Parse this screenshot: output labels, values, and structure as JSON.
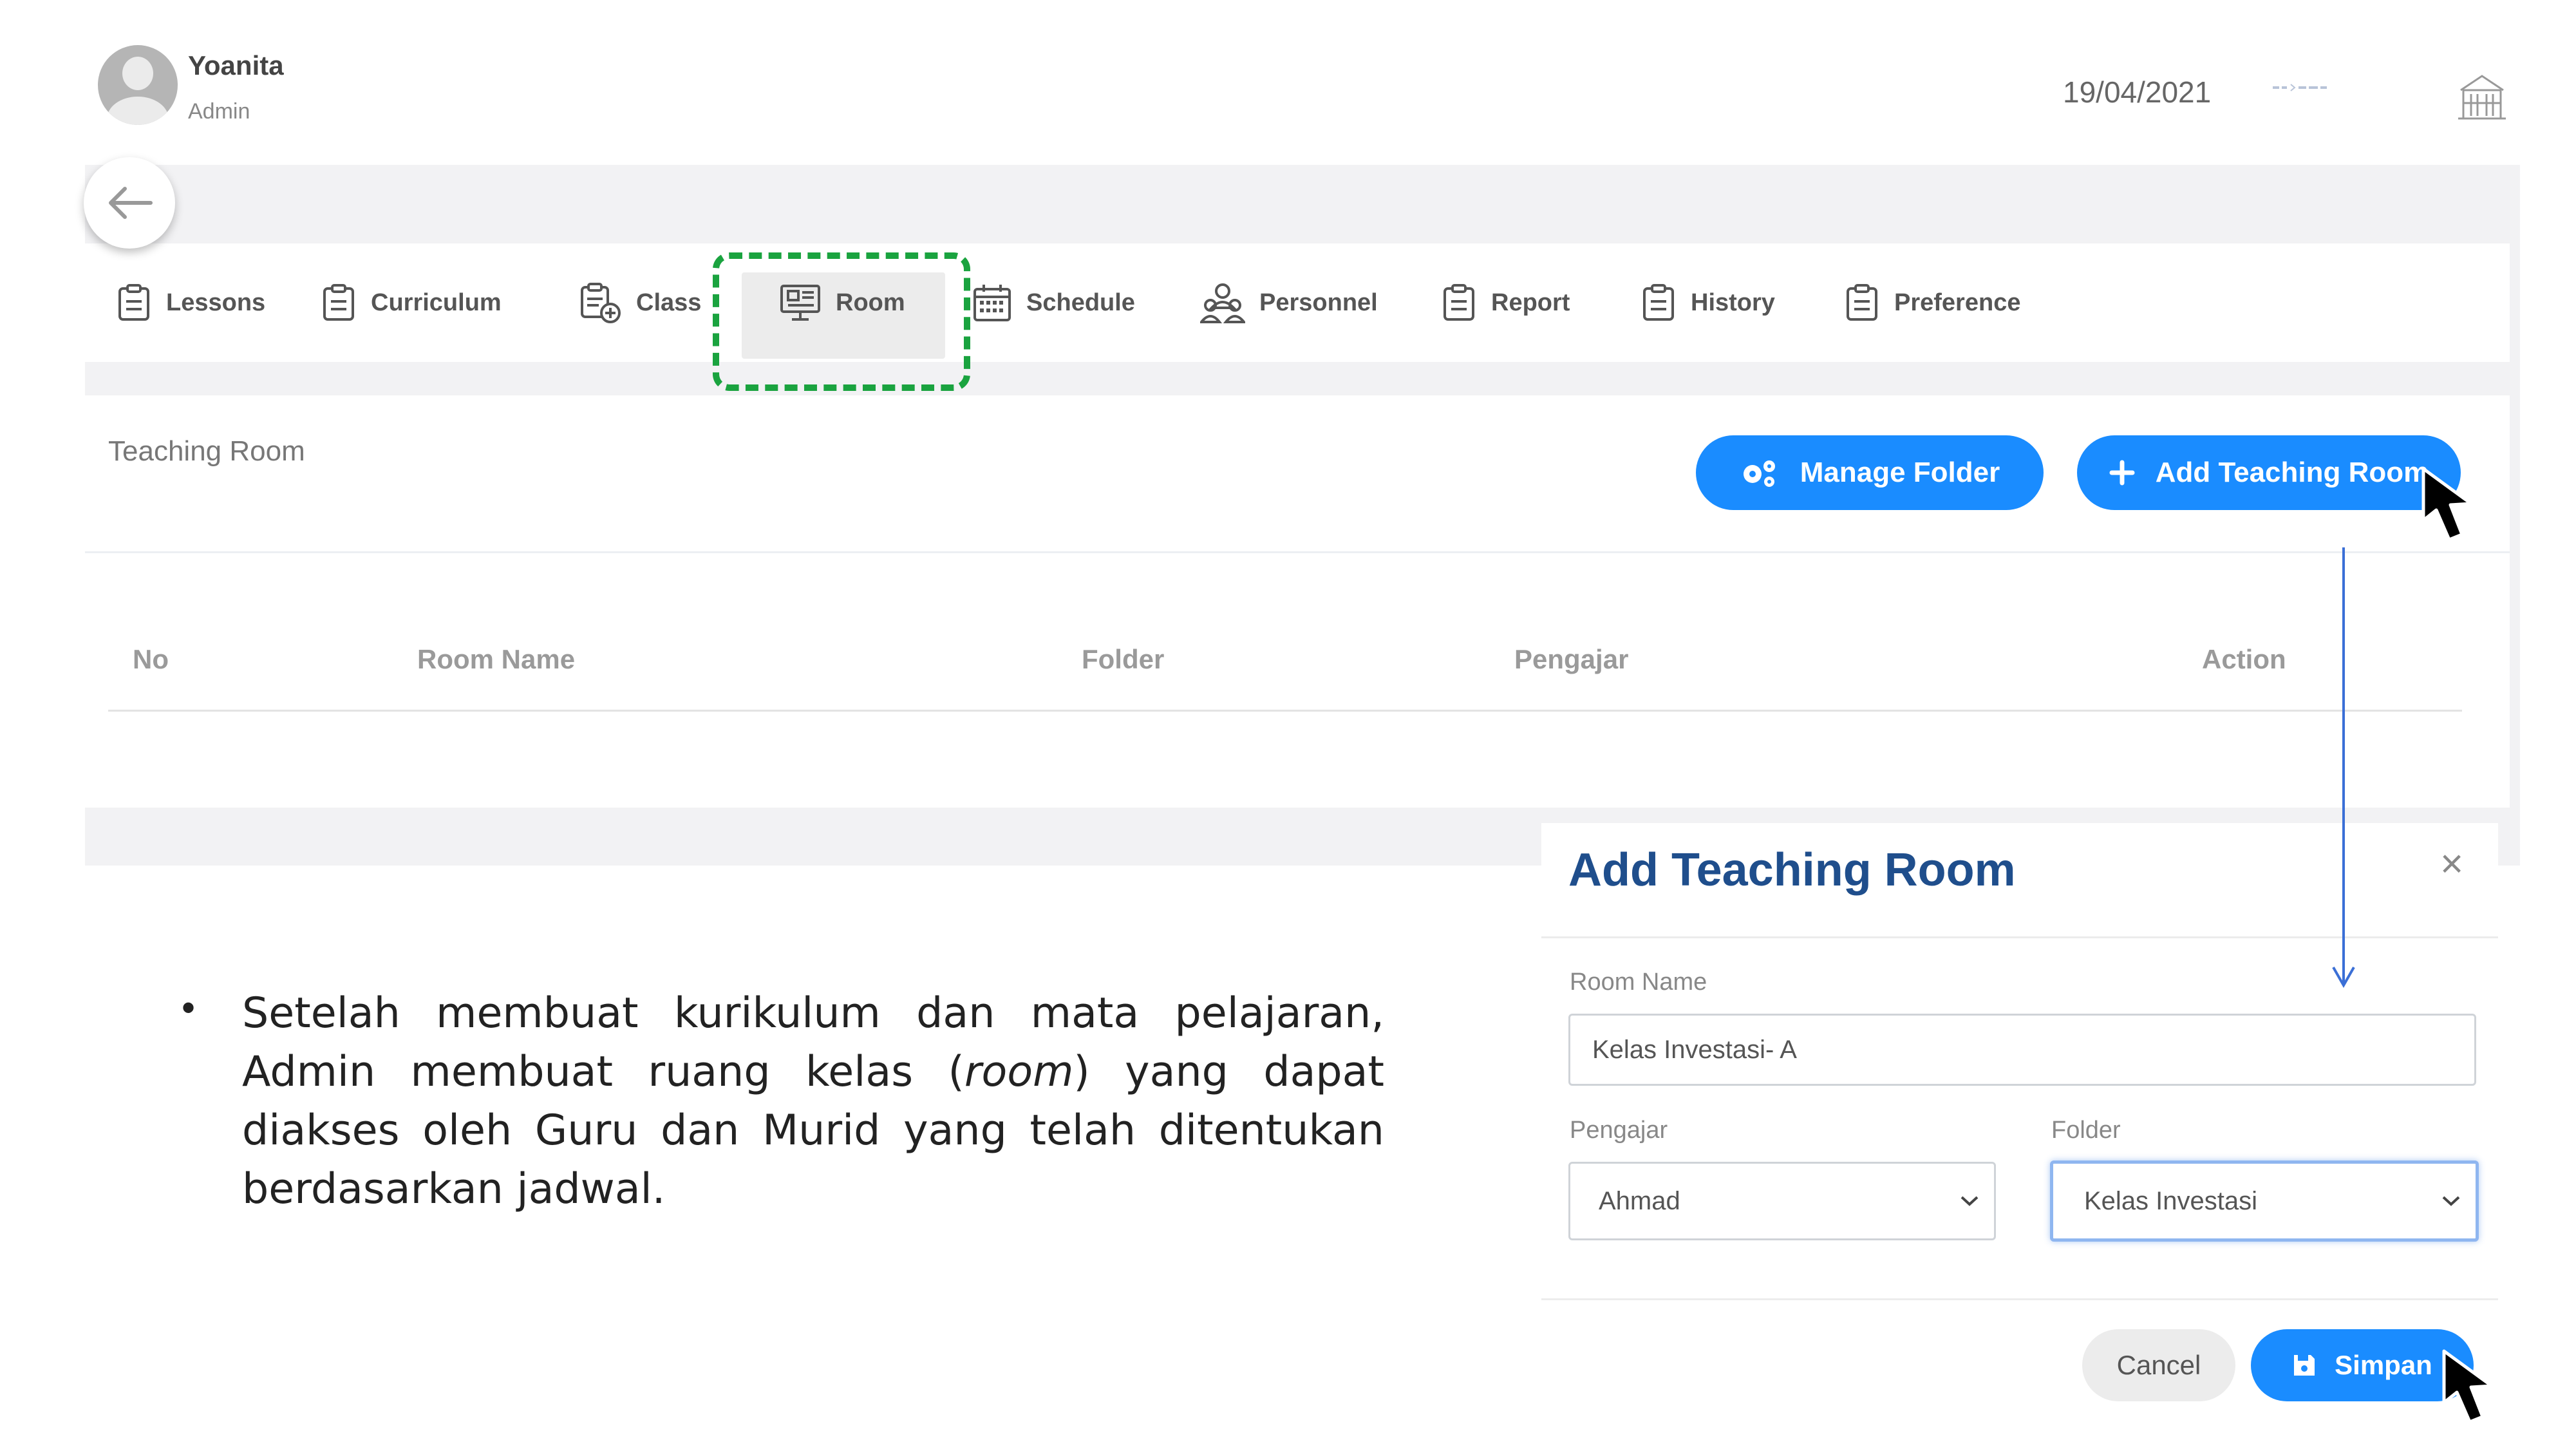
{
  "user": {
    "name": "Yoanita",
    "role": "Admin"
  },
  "header": {
    "date": "19/04/2021"
  },
  "nav": {
    "items": [
      {
        "label": "Lessons",
        "icon": "clipboard-icon"
      },
      {
        "label": "Curriculum",
        "icon": "clipboard-icon"
      },
      {
        "label": "Class",
        "icon": "clipboard-add-icon"
      },
      {
        "label": "Room",
        "icon": "monitor-icon"
      },
      {
        "label": "Schedule",
        "icon": "calendar-icon"
      },
      {
        "label": "Personnel",
        "icon": "people-icon"
      },
      {
        "label": "Report",
        "icon": "clipboard-icon"
      },
      {
        "label": "History",
        "icon": "clipboard-icon"
      },
      {
        "label": "Preference",
        "icon": "clipboard-icon"
      }
    ],
    "active": "Room"
  },
  "panel": {
    "title": "Teaching Room",
    "manage_folder_label": "Manage Folder",
    "add_room_label": "Add Teaching Room",
    "columns": [
      "No",
      "Room Name",
      "Folder",
      "Pengajar",
      "Action"
    ]
  },
  "instruction": {
    "bullet": "•",
    "text_before": "Setelah membuat kurikulum dan mata pelajaran, Admin membuat ruang kelas (",
    "text_italic": "room",
    "text_after": ") yang dapat diakses oleh Guru dan Murid yang telah ditentukan berdasarkan jadwal."
  },
  "modal": {
    "title": "Add Teaching Room",
    "close": "×",
    "room_name_label": "Room Name",
    "room_name_value": "Kelas Investasi- A",
    "pengajar_label": "Pengajar",
    "pengajar_value": "Ahmad",
    "folder_label": "Folder",
    "folder_value": "Kelas Investasi",
    "cancel_label": "Cancel",
    "save_label": "Simpan"
  },
  "colors": {
    "primary": "#1a8cff",
    "highlight": "#1aa33f",
    "modal_title": "#1f4e8c",
    "arrow": "#3b6fd6"
  }
}
